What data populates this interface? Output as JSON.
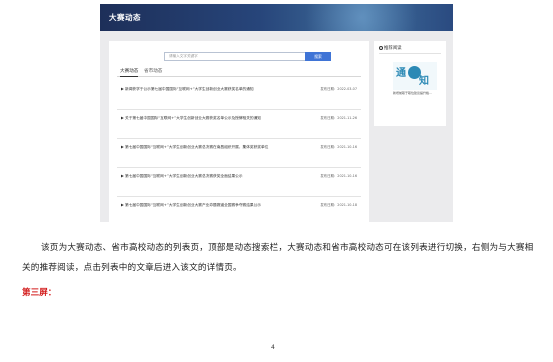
{
  "screenshot": {
    "banner_title": "大赛动态",
    "search": {
      "placeholder": "请输入文字关键字",
      "button_label": "搜索"
    },
    "tabs": [
      {
        "label": "大赛动态"
      },
      {
        "label": "省市动态"
      }
    ],
    "news": [
      {
        "title": "新闻获学于公示第七届中国国际“互联网+”大学生创新创业大赛获奖名单的通知",
        "date": "发布日期：2022-03-07"
      },
      {
        "title": "关于第七届中国国际“互联网+”大学生创新创业大赛获奖名单公示及授牌相关的通知",
        "date": "发布日期：2021-11-26"
      },
      {
        "title": "第七届中国国际“互联网+”大学生创新创业大赛总决赛在南昌组织开展，集体奖获奖单位",
        "date": "发布日期：2021-10-16"
      },
      {
        "title": "第七届中国国际“互联网+”大学生创新创业大赛总决赛获奖全面结果公示",
        "date": "发布日期：2021-10-16"
      },
      {
        "title": "第七届中国国际“互联网+”大学生创新创业大赛产业命题赛道全国赛争夺赛结果公示",
        "date": "发布日期：2021-10-18"
      }
    ],
    "sidebar": {
      "heading": "推荐阅读",
      "thumb_text_1": "通",
      "thumb_text_2": "知",
      "caption": "新增前职于职位建议提升格..."
    }
  },
  "document": {
    "paragraph": "该页为大赛动态、省市高校动态的列表页，顶部是动态搜索栏，大赛动态和省市高校动态可在该列表进行切换，右侧为与大赛相关的推荐阅读，点击列表中的文章后进入该文的详情页。",
    "section_title": "第三屏：",
    "page_number": "4"
  },
  "colors": {
    "banner": "#1d2f59",
    "search_button": "#3f74d6",
    "section_title": "#d21b1b"
  }
}
